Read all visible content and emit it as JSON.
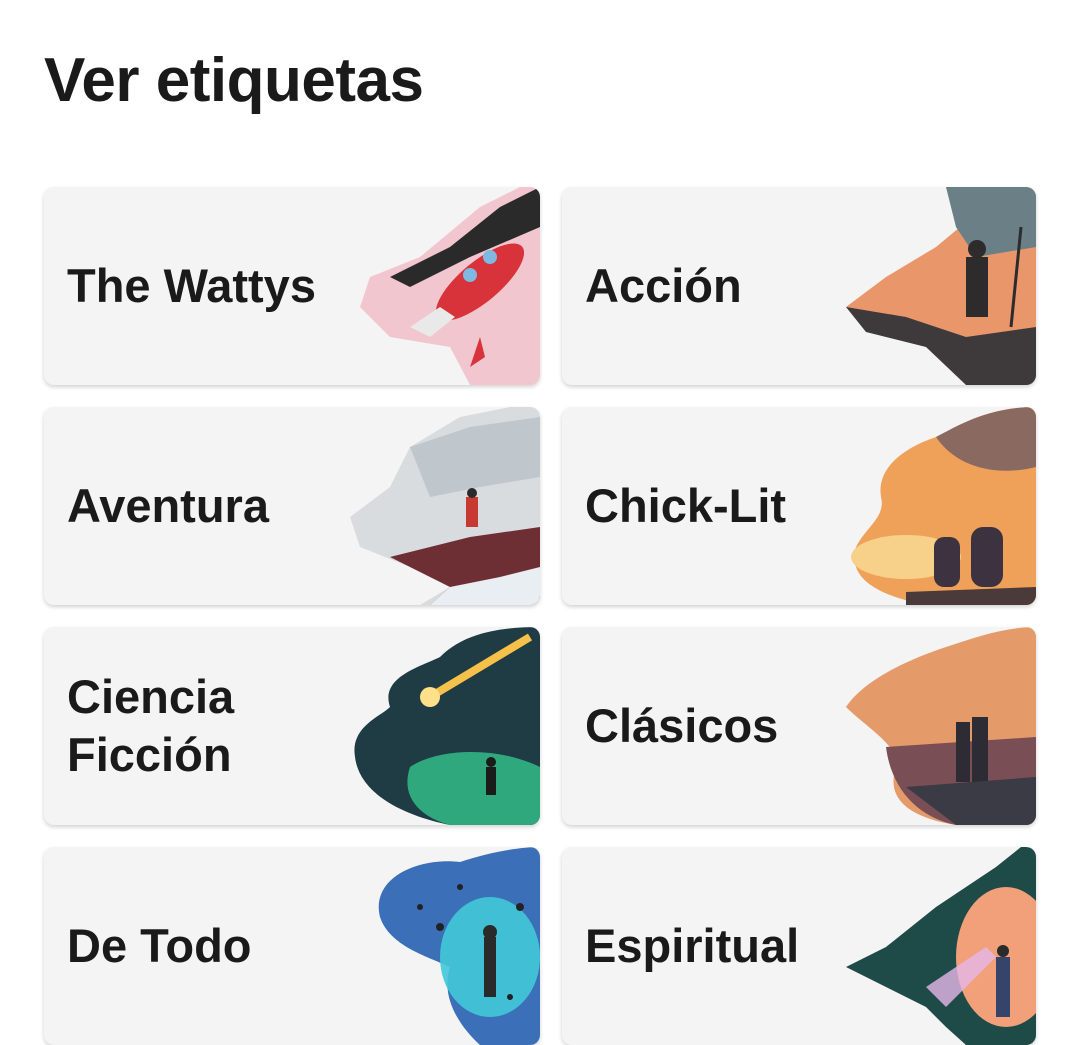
{
  "page": {
    "title": "Ver etiquetas"
  },
  "tags": [
    {
      "label": "The Wattys",
      "art": "rocket-illustration"
    },
    {
      "label": "Acción",
      "art": "soldier-illustration"
    },
    {
      "label": "Aventura",
      "art": "mountain-hiker-illustration"
    },
    {
      "label": "Chick-Lit",
      "art": "sunset-couple-illustration"
    },
    {
      "label": "Ciencia\nFicción",
      "art": "meteor-galaxy-illustration"
    },
    {
      "label": "Clásicos",
      "art": "city-sunset-couple-illustration"
    },
    {
      "label": "De Todo",
      "art": "space-astronaut-illustration"
    },
    {
      "label": "Espiritual",
      "art": "stardust-figure-illustration"
    }
  ]
}
